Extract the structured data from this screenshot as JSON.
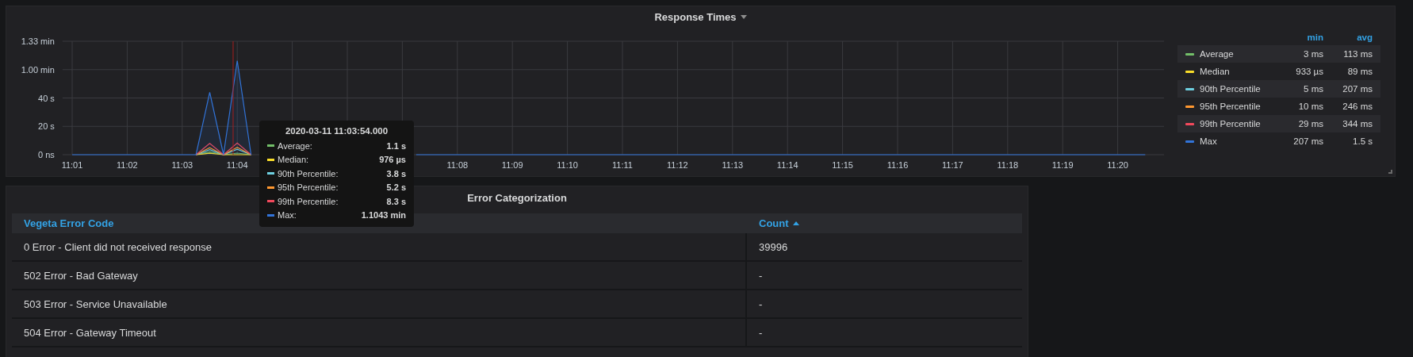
{
  "graph_panel": {
    "title": "Response Times",
    "chart_data": {
      "type": "line",
      "grid": true,
      "categories": [
        "11:01",
        null,
        null,
        null,
        "11:02",
        null,
        null,
        null,
        "11:03",
        null,
        null,
        null,
        "11:04",
        null,
        null,
        null,
        null,
        null,
        null,
        null,
        null,
        null,
        null,
        null,
        null,
        null,
        null,
        null,
        "11:08",
        null,
        null,
        null,
        "11:09",
        null,
        null,
        null,
        "11:10",
        null,
        null,
        null,
        "11:11",
        null,
        null,
        null,
        "11:12",
        null,
        null,
        null,
        "11:13",
        null,
        null,
        null,
        "11:14",
        null,
        null,
        null,
        "11:15",
        null,
        null,
        null,
        "11:16",
        null,
        null,
        null,
        "11:17",
        null,
        null,
        null,
        "11:18",
        null,
        null,
        null,
        "11:19",
        null,
        null,
        null,
        "11:20",
        null,
        null
      ],
      "ylim": [
        0,
        80
      ],
      "yticks": [
        {
          "value": 0,
          "label": "0 ns"
        },
        {
          "value": 20,
          "label": "20 s"
        },
        {
          "value": 40,
          "label": "40 s"
        }
      ],
      "series": [
        {
          "name": "Average",
          "color": "#73bf69",
          "values": [
            null,
            null,
            null,
            null,
            null,
            null,
            null,
            null,
            null,
            0,
            2,
            0,
            1.1,
            0,
            null,
            null,
            null,
            null,
            null,
            null,
            null,
            null,
            null,
            null,
            null,
            null,
            null,
            null,
            null,
            null,
            null,
            null,
            null,
            null,
            null,
            null,
            null,
            null,
            null,
            null,
            null,
            null,
            null,
            null,
            null,
            null,
            null,
            null,
            null,
            null,
            null,
            null,
            null,
            null,
            null,
            null,
            null,
            null,
            null,
            null,
            null,
            null,
            null,
            null,
            null,
            null,
            null,
            null,
            null,
            null,
            null,
            null,
            null,
            null,
            null,
            null,
            null,
            null,
            null
          ]
        },
        {
          "name": "Median",
          "color": "#fade2a",
          "values": [
            null,
            null,
            null,
            null,
            null,
            null,
            null,
            null,
            null,
            0,
            1,
            0,
            0,
            0,
            null,
            null,
            null,
            null,
            null,
            null,
            null,
            null,
            null,
            null,
            null,
            null,
            null,
            null,
            null,
            null,
            null,
            null,
            null,
            null,
            null,
            null,
            null,
            null,
            null,
            null,
            null,
            null,
            null,
            null,
            null,
            null,
            null,
            null,
            null,
            null,
            null,
            null,
            null,
            null,
            null,
            null,
            null,
            null,
            null,
            null,
            null,
            null,
            null,
            null,
            null,
            null,
            null,
            null,
            null,
            null,
            null,
            null,
            null,
            null,
            null,
            null,
            null,
            null,
            null
          ]
        },
        {
          "name": "90th Percentile",
          "color": "#6ed0e0",
          "values": [
            null,
            null,
            null,
            null,
            null,
            null,
            null,
            null,
            null,
            0,
            3.5,
            0,
            3.8,
            0,
            null,
            null,
            null,
            null,
            null,
            null,
            null,
            null,
            null,
            null,
            null,
            null,
            null,
            null,
            null,
            null,
            null,
            null,
            null,
            null,
            null,
            null,
            null,
            null,
            null,
            null,
            null,
            null,
            null,
            null,
            null,
            null,
            null,
            null,
            null,
            null,
            null,
            null,
            null,
            null,
            null,
            null,
            null,
            null,
            null,
            null,
            null,
            null,
            null,
            null,
            null,
            null,
            null,
            null,
            null,
            null,
            null,
            null,
            null,
            null,
            null,
            null,
            null,
            null,
            null
          ]
        },
        {
          "name": "95th Percentile",
          "color": "#ff9830",
          "values": [
            null,
            null,
            null,
            null,
            null,
            null,
            null,
            null,
            null,
            0,
            5,
            0,
            5.2,
            0,
            null,
            null,
            null,
            null,
            null,
            null,
            null,
            null,
            null,
            null,
            null,
            null,
            null,
            null,
            null,
            null,
            null,
            null,
            null,
            null,
            null,
            null,
            null,
            null,
            null,
            null,
            null,
            null,
            null,
            null,
            null,
            null,
            null,
            null,
            null,
            null,
            null,
            null,
            null,
            null,
            null,
            null,
            null,
            null,
            null,
            null,
            null,
            null,
            null,
            null,
            null,
            null,
            null,
            null,
            null,
            null,
            null,
            null,
            null,
            null,
            null,
            null,
            null,
            null,
            null
          ]
        },
        {
          "name": "99th Percentile",
          "color": "#f2495c",
          "values": [
            null,
            null,
            null,
            null,
            null,
            null,
            null,
            null,
            null,
            0,
            8,
            0,
            8.3,
            0,
            null,
            null,
            null,
            null,
            null,
            null,
            null,
            null,
            null,
            null,
            null,
            null,
            null,
            null,
            null,
            null,
            null,
            null,
            null,
            null,
            null,
            null,
            null,
            null,
            null,
            null,
            null,
            null,
            null,
            null,
            null,
            null,
            null,
            null,
            null,
            null,
            null,
            null,
            null,
            null,
            null,
            null,
            null,
            null,
            null,
            null,
            null,
            null,
            null,
            null,
            null,
            null,
            null,
            null,
            null,
            null,
            null,
            null,
            null,
            null,
            null,
            null,
            null,
            null,
            null
          ]
        },
        {
          "name": "Max",
          "color": "#3274d9",
          "values": [
            0,
            0,
            0,
            0,
            0,
            0,
            0,
            0,
            0,
            0,
            44,
            0,
            66.3,
            0,
            null,
            null,
            null,
            null,
            null,
            null,
            null,
            null,
            null,
            null,
            null,
            0,
            0,
            0,
            0,
            0,
            0,
            0,
            0,
            0,
            0,
            0,
            0,
            0,
            0,
            0,
            0,
            0,
            0,
            0,
            0,
            0,
            0,
            0,
            0,
            0,
            0,
            0,
            0,
            0,
            0,
            0,
            0,
            0,
            0,
            0,
            0,
            0,
            0,
            0,
            0,
            0,
            0,
            0,
            0,
            0,
            0,
            0,
            0,
            0,
            0,
            0,
            0,
            0,
            0
          ]
        }
      ]
    },
    "y_axis_minute_labels": [
      "1.33 min",
      "1.00 min"
    ],
    "legend": {
      "columns": [
        "min",
        "avg"
      ],
      "rows": [
        {
          "min": "3 ms",
          "avg": "113 ms"
        },
        {
          "min": "933 µs",
          "avg": "89 ms"
        },
        {
          "min": "5 ms",
          "avg": "207 ms"
        },
        {
          "min": "10 ms",
          "avg": "246 ms"
        },
        {
          "min": "29 ms",
          "avg": "344 ms"
        },
        {
          "min": "207 ms",
          "avg": "1.5 s"
        }
      ]
    },
    "tooltip": {
      "time": "2020-03-11 11:03:54.000",
      "rows": [
        {
          "name": "Average:",
          "color": "#73bf69",
          "value": "1.1 s"
        },
        {
          "name": "Median:",
          "color": "#fade2a",
          "value": "976 µs"
        },
        {
          "name": "90th Percentile:",
          "color": "#6ed0e0",
          "value": "3.8 s"
        },
        {
          "name": "95th Percentile:",
          "color": "#ff9830",
          "value": "5.2 s"
        },
        {
          "name": "99th Percentile:",
          "color": "#f2495c",
          "value": "8.3 s"
        },
        {
          "name": "Max:",
          "color": "#3274d9",
          "value": "1.1043 min"
        }
      ]
    }
  },
  "table_panel": {
    "title": "Error Categorization",
    "columns": [
      {
        "label": "Vegeta Error Code",
        "sorted": false
      },
      {
        "label": "Count",
        "sorted": true
      }
    ],
    "rows": [
      [
        "0 Error - Client did not received response",
        "39996"
      ],
      [
        "502 Error - Bad Gateway",
        "-"
      ],
      [
        "503 Error - Service Unavailable",
        "-"
      ],
      [
        "504 Error - Gateway Timeout",
        "-"
      ]
    ]
  }
}
